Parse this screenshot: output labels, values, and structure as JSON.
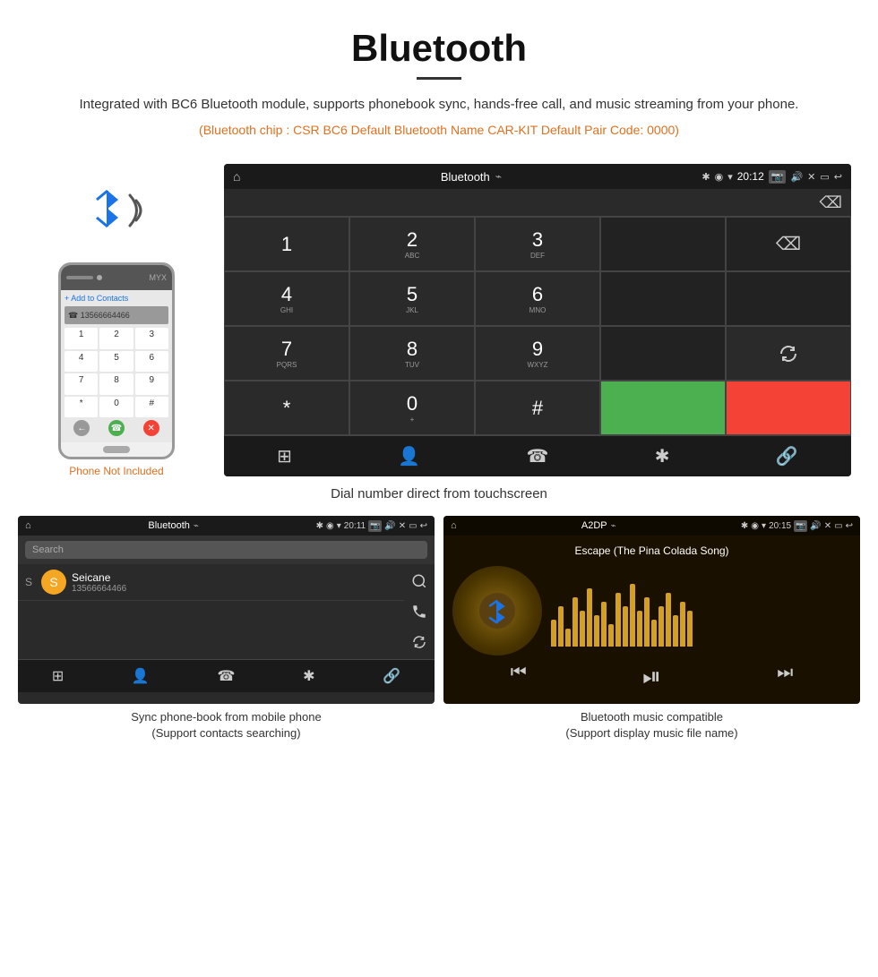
{
  "header": {
    "title": "Bluetooth",
    "description": "Integrated with BC6 Bluetooth module, supports phonebook sync, hands-free call, and music streaming from your phone.",
    "specs": "(Bluetooth chip : CSR BC6    Default Bluetooth Name CAR-KIT    Default Pair Code: 0000)"
  },
  "dialpad_screen": {
    "app_name": "Bluetooth",
    "status_time": "20:12",
    "keys": [
      {
        "main": "1",
        "sub": ""
      },
      {
        "main": "2",
        "sub": "ABC"
      },
      {
        "main": "3",
        "sub": "DEF"
      },
      {
        "main": "",
        "sub": ""
      },
      {
        "main": "⌫",
        "sub": ""
      },
      {
        "main": "4",
        "sub": "GHI"
      },
      {
        "main": "5",
        "sub": "JKL"
      },
      {
        "main": "6",
        "sub": "MNO"
      },
      {
        "main": "",
        "sub": ""
      },
      {
        "main": "",
        "sub": ""
      },
      {
        "main": "7",
        "sub": "PQRS"
      },
      {
        "main": "8",
        "sub": "TUV"
      },
      {
        "main": "9",
        "sub": "WXYZ"
      },
      {
        "main": "",
        "sub": ""
      },
      {
        "main": "↺",
        "sub": ""
      },
      {
        "main": "*",
        "sub": ""
      },
      {
        "main": "0",
        "sub": "+"
      },
      {
        "main": "#",
        "sub": ""
      },
      {
        "main": "📞",
        "sub": ""
      },
      {
        "main": "📵",
        "sub": ""
      }
    ],
    "bottom_icons": [
      "⊞",
      "👤",
      "☎",
      "✱",
      "🔗"
    ]
  },
  "caption_dialpad": "Dial number direct from touchscreen",
  "phonebook_screen": {
    "app_name": "Bluetooth",
    "status_time": "20:11",
    "search_placeholder": "Search",
    "contacts": [
      {
        "letter": "S",
        "name": "Seicane",
        "number": "13566664466"
      }
    ],
    "side_icons": [
      "🔍",
      "📞",
      "↺"
    ]
  },
  "caption_phonebook": "Sync phone-book from mobile phone\n(Support contacts searching)",
  "music_screen": {
    "app_name": "A2DP",
    "status_time": "20:15",
    "song_title": "Escape (The Pina Colada Song)",
    "visualizer_bars": [
      30,
      45,
      20,
      55,
      40,
      65,
      35,
      50,
      25,
      60,
      45,
      70,
      40,
      55,
      30,
      45,
      60,
      35,
      50,
      40
    ],
    "controls": [
      "⏮",
      "⏯",
      "⏭"
    ]
  },
  "caption_music": "Bluetooth music compatible\n(Support display music file name)",
  "phone_not_included": "Phone Not Included",
  "colors": {
    "orange": "#e07020",
    "android_bg": "#2a2a2a",
    "android_dark": "#1a1a1a",
    "green_call": "#4caf50",
    "red_call": "#f44336"
  }
}
